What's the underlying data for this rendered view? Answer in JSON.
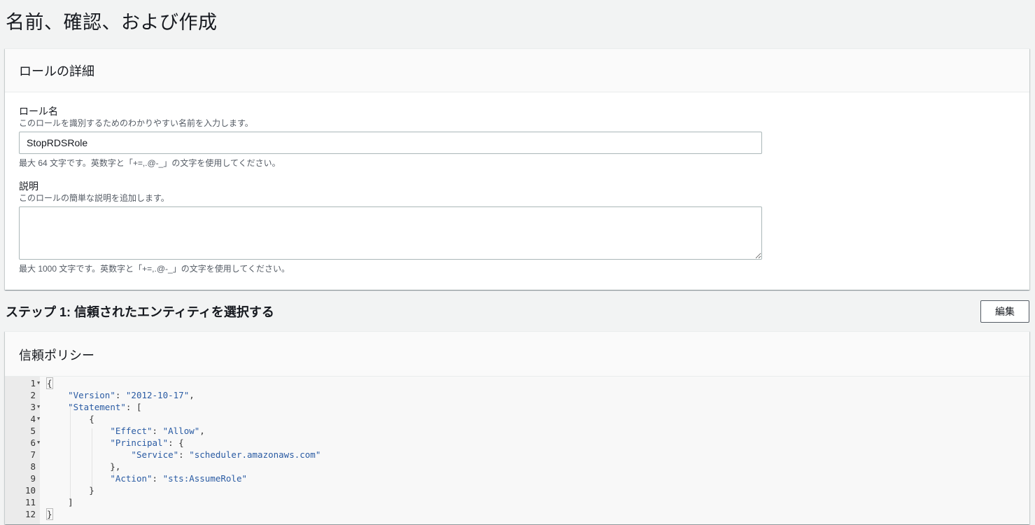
{
  "page": {
    "title": "名前、確認、および作成"
  },
  "role_details": {
    "header": "ロールの詳細",
    "role_name": {
      "label": "ロール名",
      "description": "このロールを識別するためのわかりやすい名前を入力します。",
      "value": "StopRDSRole",
      "constraint": "最大 64 文字です。英数字と「+=,.@-_」の文字を使用してください。"
    },
    "description": {
      "label": "説明",
      "description": "このロールの簡単な説明を追加します。",
      "value": "",
      "constraint": "最大 1000 文字です。英数字と「+=,.@-_」の文字を使用してください。"
    }
  },
  "step1": {
    "title": "ステップ 1: 信頼されたエンティティを選択する",
    "edit_label": "編集"
  },
  "trust_policy": {
    "header": "信頼ポリシー",
    "lines": [
      {
        "n": "1",
        "fold": true,
        "text": "{"
      },
      {
        "n": "2",
        "fold": false,
        "text": "    \"Version\": \"2012-10-17\","
      },
      {
        "n": "3",
        "fold": true,
        "text": "    \"Statement\": ["
      },
      {
        "n": "4",
        "fold": true,
        "text": "        {"
      },
      {
        "n": "5",
        "fold": false,
        "text": "            \"Effect\": \"Allow\","
      },
      {
        "n": "6",
        "fold": true,
        "text": "            \"Principal\": {"
      },
      {
        "n": "7",
        "fold": false,
        "text": "                \"Service\": \"scheduler.amazonaws.com\""
      },
      {
        "n": "8",
        "fold": false,
        "text": "            },"
      },
      {
        "n": "9",
        "fold": false,
        "text": "            \"Action\": \"sts:AssumeRole\""
      },
      {
        "n": "10",
        "fold": false,
        "text": "        }"
      },
      {
        "n": "11",
        "fold": false,
        "text": "    ]"
      },
      {
        "n": "12",
        "fold": false,
        "text": "}"
      }
    ]
  },
  "colors": {
    "background": "#f2f3f3",
    "panel_header": "#fafafa",
    "code_key": "#2a5ba3",
    "muted_text": "#545b64"
  }
}
